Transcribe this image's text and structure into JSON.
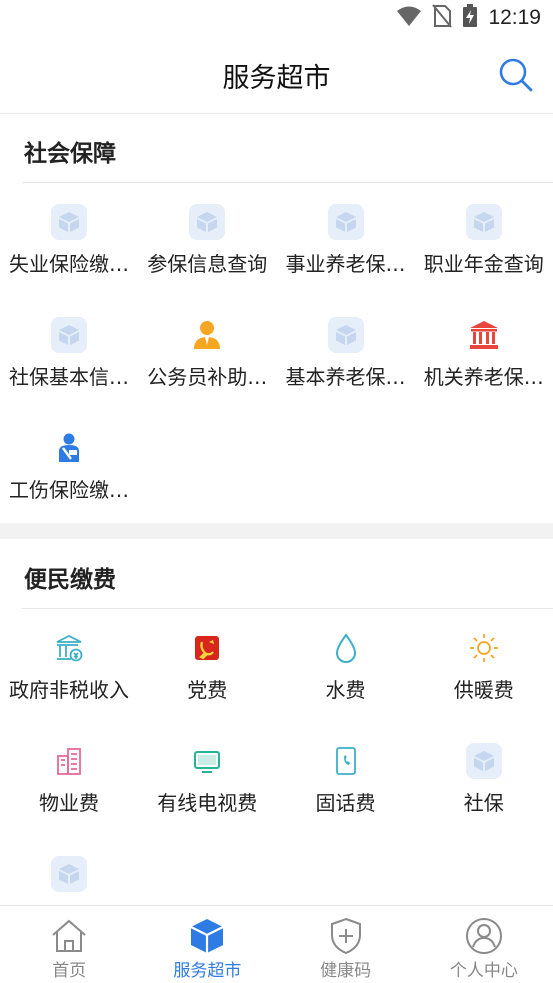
{
  "status_bar": {
    "time": "12:19"
  },
  "header": {
    "title": "服务超市"
  },
  "sections": [
    {
      "title": "社会保障",
      "items": [
        {
          "label": "失业保险缴…",
          "icon": "box-icon"
        },
        {
          "label": "参保信息查询",
          "icon": "box-icon"
        },
        {
          "label": "事业养老保…",
          "icon": "box-icon"
        },
        {
          "label": "职业年金查询",
          "icon": "box-icon"
        },
        {
          "label": "社保基本信…",
          "icon": "box-icon"
        },
        {
          "label": "公务员补助…",
          "icon": "civil-servant-icon"
        },
        {
          "label": "基本养老保…",
          "icon": "box-icon"
        },
        {
          "label": "机关养老保…",
          "icon": "government-building-icon"
        },
        {
          "label": "工伤保险缴…",
          "icon": "injured-person-icon"
        }
      ]
    },
    {
      "title": "便民缴费",
      "items": [
        {
          "label": "政府非税收入",
          "icon": "government-revenue-icon"
        },
        {
          "label": "党费",
          "icon": "party-emblem-icon"
        },
        {
          "label": "水费",
          "icon": "water-drop-icon"
        },
        {
          "label": "供暖费",
          "icon": "sun-icon"
        },
        {
          "label": "物业费",
          "icon": "buildings-icon"
        },
        {
          "label": "有线电视费",
          "icon": "tv-icon"
        },
        {
          "label": "固话费",
          "icon": "phone-icon"
        },
        {
          "label": "社保",
          "icon": "box-icon"
        },
        {
          "label": "",
          "icon": "box-icon"
        }
      ]
    }
  ],
  "tabbar": [
    {
      "label": "首页",
      "icon": "home-icon",
      "active": false
    },
    {
      "label": "服务超市",
      "icon": "cube-icon",
      "active": true
    },
    {
      "label": "健康码",
      "icon": "health-shield-icon",
      "active": false
    },
    {
      "label": "个人中心",
      "icon": "profile-icon",
      "active": false
    }
  ],
  "colors": {
    "accent": "#2f7be4",
    "box_icon": "#c5d6ee",
    "civil_servant": "#f5a623",
    "government_building": "#e8453c",
    "injured_person": "#2f7be4",
    "government_revenue": "#3ab0c9",
    "party_emblem": "#d9261c",
    "water": "#3ab0c9",
    "sun": "#f5a623",
    "buildings": "#e86a96",
    "tv": "#26b39a",
    "phone": "#3ab0c9"
  }
}
